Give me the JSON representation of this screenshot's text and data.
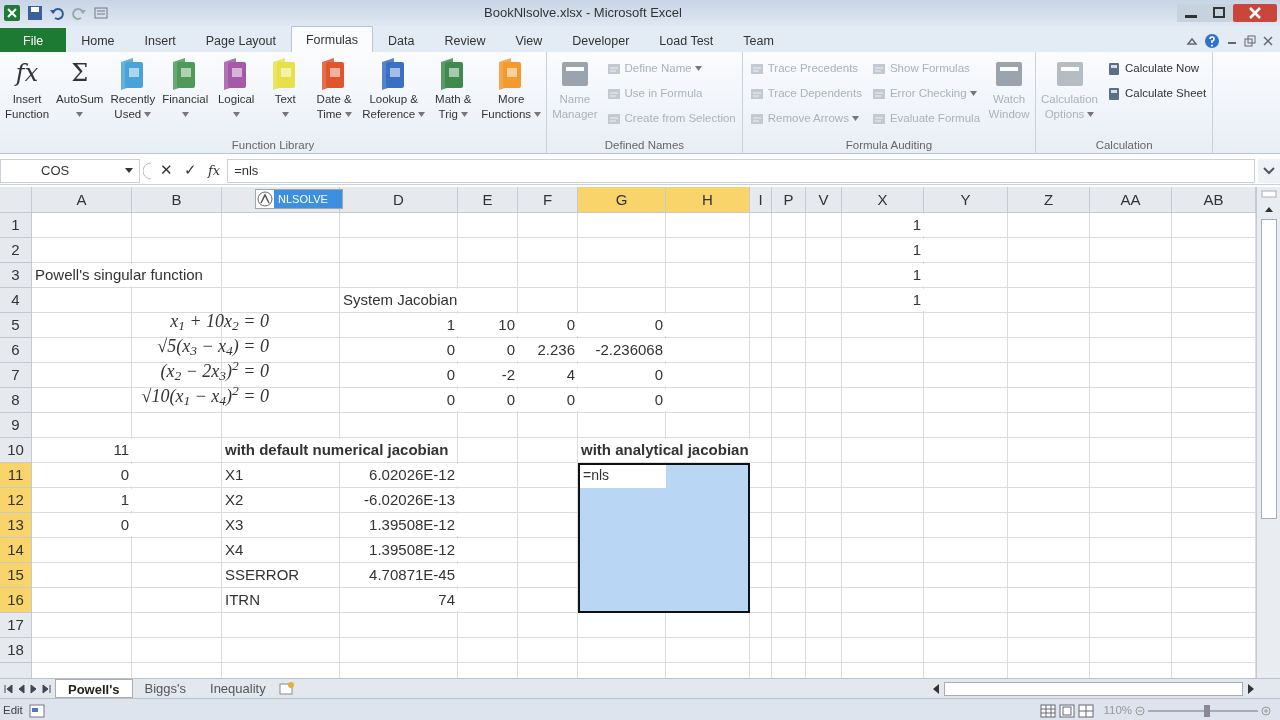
{
  "window": {
    "title": "BookNlsolve.xlsx - Microsoft Excel"
  },
  "tabs": [
    {
      "label": "File",
      "kind": "file",
      "selected": false
    },
    {
      "label": "Home",
      "kind": "tab",
      "selected": false
    },
    {
      "label": "Insert",
      "kind": "tab",
      "selected": false
    },
    {
      "label": "Page Layout",
      "kind": "tab",
      "selected": false
    },
    {
      "label": "Formulas",
      "kind": "tab",
      "selected": true
    },
    {
      "label": "Data",
      "kind": "tab",
      "selected": false
    },
    {
      "label": "Review",
      "kind": "tab",
      "selected": false
    },
    {
      "label": "View",
      "kind": "tab",
      "selected": false
    },
    {
      "label": "Developer",
      "kind": "tab",
      "selected": false
    },
    {
      "label": "Load Test",
      "kind": "tab",
      "selected": false
    },
    {
      "label": "Team",
      "kind": "tab",
      "selected": false
    }
  ],
  "ribbon": [
    {
      "label": "Function Library",
      "items": [
        {
          "kind": "large",
          "lines": [
            "Insert",
            "Function"
          ],
          "glyph": "fx",
          "dropdown": false,
          "disabled": false
        },
        {
          "kind": "large",
          "lines": [
            "AutoSum"
          ],
          "glyph": "Σ",
          "dropdown": true,
          "disabled": false
        },
        {
          "kind": "large",
          "lines": [
            "Recently",
            "Used"
          ],
          "color": "#4aa3d8",
          "dropdown": true,
          "disabled": false
        },
        {
          "kind": "large",
          "lines": [
            "Financial"
          ],
          "color": "#4f9a5a",
          "dropdown": true,
          "disabled": false
        },
        {
          "kind": "large",
          "lines": [
            "Logical"
          ],
          "color": "#a45aa8",
          "dropdown": true,
          "disabled": false
        },
        {
          "kind": "large",
          "lines": [
            "Text"
          ],
          "color": "#e8e04a",
          "dropdown": true,
          "disabled": false
        },
        {
          "kind": "large",
          "lines": [
            "Date &",
            "Time"
          ],
          "color": "#e0552b",
          "dropdown": true,
          "disabled": false
        },
        {
          "kind": "large",
          "lines": [
            "Lookup &",
            "Reference"
          ],
          "color": "#3b6fc4",
          "dropdown": true,
          "disabled": false
        },
        {
          "kind": "large",
          "lines": [
            "Math &",
            "Trig"
          ],
          "color": "#3f8a4c",
          "dropdown": true,
          "disabled": false
        },
        {
          "kind": "large",
          "lines": [
            "More",
            "Functions"
          ],
          "color": "#f29a2e",
          "dropdown": true,
          "disabled": false
        }
      ]
    },
    {
      "label": "Defined Names",
      "items": [
        {
          "kind": "large",
          "lines": [
            "Name",
            "Manager"
          ],
          "color": "#9aa4ae",
          "dropdown": false,
          "disabled": true
        },
        {
          "kind": "stack",
          "items": [
            {
              "label": "Define Name",
              "dropdown": true,
              "disabled": true
            },
            {
              "label": "Use in Formula",
              "dropdown": false,
              "disabled": true
            },
            {
              "label": "Create from Selection",
              "dropdown": false,
              "disabled": true
            }
          ]
        }
      ]
    },
    {
      "label": "Formula Auditing",
      "items": [
        {
          "kind": "stack",
          "items": [
            {
              "label": "Trace Precedents",
              "dropdown": false,
              "disabled": true
            },
            {
              "label": "Trace Dependents",
              "dropdown": false,
              "disabled": true
            },
            {
              "label": "Remove Arrows",
              "dropdown": true,
              "disabled": true
            }
          ]
        },
        {
          "kind": "stack",
          "items": [
            {
              "label": "Show Formulas",
              "dropdown": false,
              "disabled": true
            },
            {
              "label": "Error Checking",
              "dropdown": true,
              "disabled": true
            },
            {
              "label": "Evaluate Formula",
              "dropdown": false,
              "disabled": true
            }
          ]
        },
        {
          "kind": "large",
          "lines": [
            "Watch",
            "Window"
          ],
          "color": "#9aa4ae",
          "dropdown": false,
          "disabled": true
        }
      ]
    },
    {
      "label": "Calculation",
      "items": [
        {
          "kind": "large",
          "lines": [
            "Calculation",
            "Options"
          ],
          "color": "#b4bcc4",
          "dropdown": true,
          "disabled": true
        },
        {
          "kind": "stack",
          "items": [
            {
              "label": "Calculate Now",
              "dropdown": false,
              "disabled": false
            },
            {
              "label": "Calculate Sheet",
              "dropdown": false,
              "disabled": false
            }
          ]
        }
      ]
    }
  ],
  "formula_bar": {
    "name_box": "COS",
    "buttons": [
      "✕",
      "✓",
      "fx"
    ],
    "formula": "=nls"
  },
  "autocomplete": [
    {
      "label": "NLSOLVE",
      "selected": true
    }
  ],
  "columns": [
    {
      "label": "A",
      "selected": false
    },
    {
      "label": "B",
      "selected": false
    },
    {
      "selected": false
    },
    {
      "label": "D",
      "selected": false
    },
    {
      "label": "E",
      "selected": false
    },
    {
      "label": "F",
      "selected": false
    },
    {
      "label": "G",
      "selected": true
    },
    {
      "label": "H",
      "selected": true
    },
    {
      "label": "I",
      "selected": false
    },
    {
      "label": "P",
      "selected": false
    },
    {
      "label": "V",
      "selected": false
    },
    {
      "label": "X",
      "selected": false
    },
    {
      "label": "Y",
      "selected": false
    },
    {
      "label": "Z",
      "selected": false
    },
    {
      "label": "AA",
      "selected": false
    },
    {
      "label": "AB",
      "selected": false
    }
  ],
  "rows": [
    {
      "label": "1",
      "selected": false,
      "cells": [
        null,
        null,
        null,
        null,
        null,
        null,
        null,
        null,
        null,
        null,
        null,
        {
          "kind": "number",
          "text": "1"
        },
        null,
        null,
        null,
        null
      ]
    },
    {
      "label": "2",
      "selected": false,
      "cells": [
        null,
        null,
        null,
        null,
        null,
        null,
        null,
        null,
        null,
        null,
        null,
        {
          "kind": "number",
          "text": "1"
        },
        null,
        null,
        null,
        null
      ]
    },
    {
      "label": "3",
      "selected": false,
      "cells": [
        {
          "kind": "text",
          "text": "Powell's singular function"
        },
        null,
        null,
        null,
        null,
        null,
        null,
        null,
        null,
        null,
        null,
        {
          "kind": "number",
          "text": "1"
        },
        null,
        null,
        null,
        null
      ]
    },
    {
      "label": "4",
      "selected": false,
      "cells": [
        null,
        null,
        null,
        {
          "kind": "text",
          "text": "System Jacobian"
        },
        null,
        null,
        null,
        null,
        null,
        null,
        null,
        {
          "kind": "number",
          "text": "1"
        },
        null,
        null,
        null,
        null
      ]
    },
    {
      "label": "5",
      "selected": false,
      "cells": [
        null,
        {
          "kind": "equation",
          "text": "x$_{1}$ + 10x$_{2}$ = 0"
        },
        null,
        {
          "kind": "number",
          "text": "1"
        },
        {
          "kind": "number",
          "text": "10"
        },
        {
          "kind": "number",
          "text": "0"
        },
        {
          "kind": "number",
          "text": "0"
        },
        null,
        null,
        null,
        null,
        null,
        null,
        null,
        null,
        null
      ]
    },
    {
      "label": "6",
      "selected": false,
      "cells": [
        null,
        {
          "kind": "equation",
          "text": "√5(x$_{3}$ − x$_{4}$) = 0"
        },
        null,
        {
          "kind": "number",
          "text": "0"
        },
        {
          "kind": "number",
          "text": "0"
        },
        {
          "kind": "number",
          "text": "2.236"
        },
        {
          "kind": "number",
          "text": "-2.236068"
        },
        null,
        null,
        null,
        null,
        null,
        null,
        null,
        null,
        null
      ]
    },
    {
      "label": "7",
      "selected": false,
      "cells": [
        null,
        {
          "kind": "equation",
          "text": "(x$_{2}$ − 2x$_{3}$)$^{2}$ = 0"
        },
        null,
        {
          "kind": "number",
          "text": "0"
        },
        {
          "kind": "number",
          "text": "-2"
        },
        {
          "kind": "number",
          "text": "4"
        },
        {
          "kind": "number",
          "text": "0"
        },
        null,
        null,
        null,
        null,
        null,
        null,
        null,
        null,
        null
      ]
    },
    {
      "label": "8",
      "selected": false,
      "cells": [
        null,
        {
          "kind": "equation",
          "text": "√10(x$_{1}$ − x$_{4}$)$^{2}$ = 0"
        },
        null,
        {
          "kind": "number",
          "text": "0"
        },
        {
          "kind": "number",
          "text": "0"
        },
        {
          "kind": "number",
          "text": "0"
        },
        {
          "kind": "number",
          "text": "0"
        },
        null,
        null,
        null,
        null,
        null,
        null,
        null,
        null,
        null
      ]
    },
    {
      "label": "9",
      "selected": false,
      "cells": [
        null,
        null,
        null,
        null,
        null,
        null,
        null,
        null,
        null,
        null,
        null,
        null,
        null,
        null,
        null,
        null
      ]
    },
    {
      "label": "10",
      "selected": false,
      "cells": [
        {
          "kind": "number",
          "text": "11"
        },
        null,
        {
          "kind": "heading",
          "text": "with default numerical jacobian"
        },
        null,
        null,
        null,
        {
          "kind": "heading",
          "text": "with analytical jacobian"
        },
        null,
        null,
        null,
        null,
        null,
        null,
        null,
        null,
        null
      ]
    },
    {
      "label": "11",
      "selected": true,
      "cells": [
        {
          "kind": "number",
          "text": "0"
        },
        null,
        {
          "kind": "text",
          "text": "X1"
        },
        {
          "kind": "number",
          "text": "6.02026E-12"
        },
        null,
        null,
        {
          "kind": "editing",
          "text": "=nls"
        },
        null,
        null,
        null,
        null,
        null,
        null,
        null,
        null,
        null
      ]
    },
    {
      "label": "12",
      "selected": true,
      "cells": [
        {
          "kind": "number",
          "text": "1"
        },
        null,
        {
          "kind": "text",
          "text": "X2"
        },
        {
          "kind": "number",
          "text": "-6.02026E-13"
        },
        null,
        null,
        null,
        null,
        null,
        null,
        null,
        null,
        null,
        null,
        null,
        null
      ]
    },
    {
      "label": "13",
      "selected": true,
      "cells": [
        {
          "kind": "number",
          "text": "0"
        },
        null,
        {
          "kind": "text",
          "text": "X3"
        },
        {
          "kind": "number",
          "text": "1.39508E-12"
        },
        null,
        null,
        null,
        null,
        null,
        null,
        null,
        null,
        null,
        null,
        null,
        null
      ]
    },
    {
      "label": "14",
      "selected": true,
      "cells": [
        null,
        null,
        {
          "kind": "text",
          "text": "X4"
        },
        {
          "kind": "number",
          "text": "1.39508E-12"
        },
        null,
        null,
        null,
        null,
        null,
        null,
        null,
        null,
        null,
        null,
        null,
        null
      ]
    },
    {
      "label": "15",
      "selected": true,
      "cells": [
        null,
        null,
        {
          "kind": "text",
          "text": "SSERROR"
        },
        {
          "kind": "number",
          "text": "4.70871E-45"
        },
        null,
        null,
        null,
        null,
        null,
        null,
        null,
        null,
        null,
        null,
        null,
        null
      ]
    },
    {
      "label": "16",
      "selected": true,
      "cells": [
        null,
        null,
        {
          "kind": "text",
          "text": "ITRN"
        },
        {
          "kind": "number",
          "text": "74"
        },
        null,
        null,
        null,
        null,
        null,
        null,
        null,
        null,
        null,
        null,
        null,
        null
      ]
    },
    {
      "label": "17",
      "selected": false,
      "cells": [
        null,
        null,
        null,
        null,
        null,
        null,
        null,
        null,
        null,
        null,
        null,
        null,
        null,
        null,
        null,
        null
      ]
    },
    {
      "label": "18",
      "selected": false,
      "cells": [
        null,
        null,
        null,
        null,
        null,
        null,
        null,
        null,
        null,
        null,
        null,
        null,
        null,
        null,
        null,
        null
      ]
    }
  ],
  "sheet_tabs": [
    {
      "label": "Powell's",
      "selected": true
    },
    {
      "label": "Biggs's",
      "selected": false
    },
    {
      "label": "Inequality",
      "selected": false
    }
  ],
  "status_bar": {
    "mode": "Edit",
    "zoom": "110%"
  }
}
